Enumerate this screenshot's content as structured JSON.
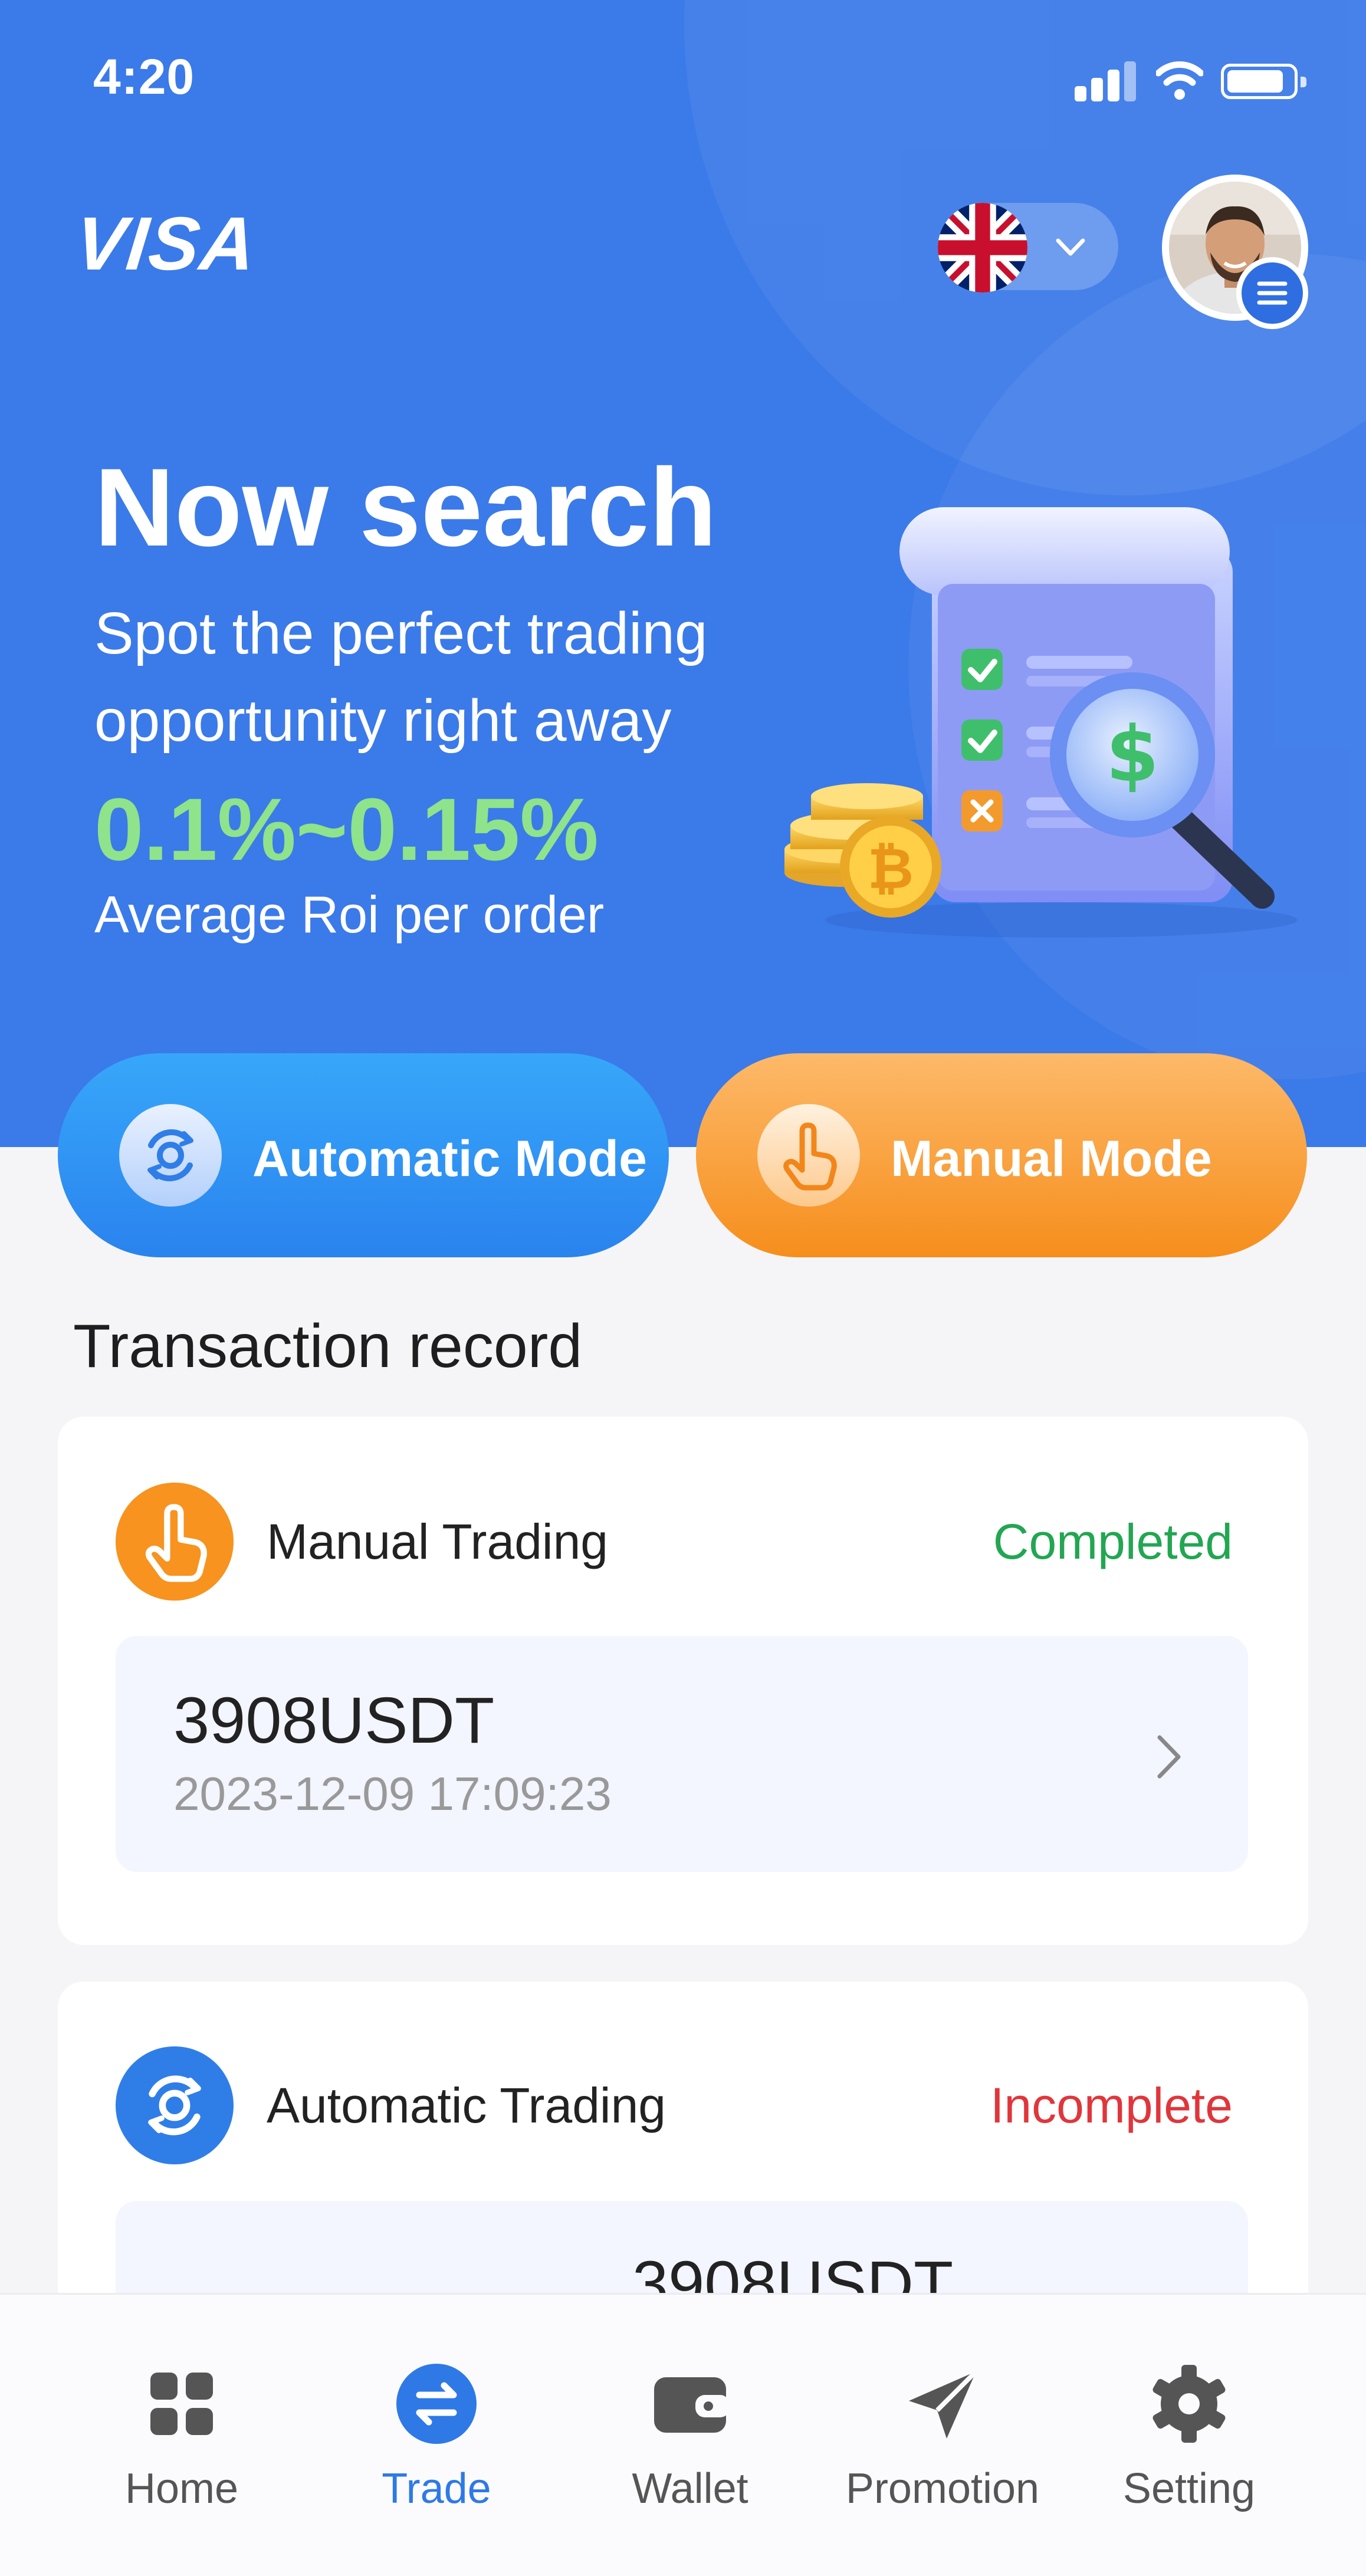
{
  "status_bar": {
    "time": "4:20"
  },
  "header": {
    "logo": "VISA",
    "language_icon": "uk-flag-icon",
    "menu_icon": "menu-icon"
  },
  "hero": {
    "title": "Now search",
    "subtitle": "Spot the perfect trading opportunity right away",
    "roi": "0.1%~0.15%",
    "roi_label": "Average Roi per order"
  },
  "modes": {
    "automatic": "Automatic Mode",
    "manual": "Manual Mode"
  },
  "transactions": {
    "title": "Transaction record",
    "records": [
      {
        "type": "Manual Trading",
        "status": "Completed",
        "amount": "3908USDT",
        "date": "2023-12-09 17:09:23"
      },
      {
        "type": "Automatic Trading",
        "status": "Incomplete",
        "amount": "3908USDT",
        "date": ""
      }
    ]
  },
  "tabs": [
    {
      "label": "Home",
      "icon": "grid-icon"
    },
    {
      "label": "Trade",
      "icon": "swap-icon",
      "active": true
    },
    {
      "label": "Wallet",
      "icon": "wallet-icon"
    },
    {
      "label": "Promotion",
      "icon": "paper-plane-icon"
    },
    {
      "label": "Setting",
      "icon": "gear-icon"
    }
  ],
  "colors": {
    "primary": "#3b7ae9",
    "roi_green": "#8ee38b",
    "completed": "#22a652",
    "incomplete": "#e0363b",
    "manual_orange": "#f7931e",
    "tab_active": "#2e79e6"
  }
}
